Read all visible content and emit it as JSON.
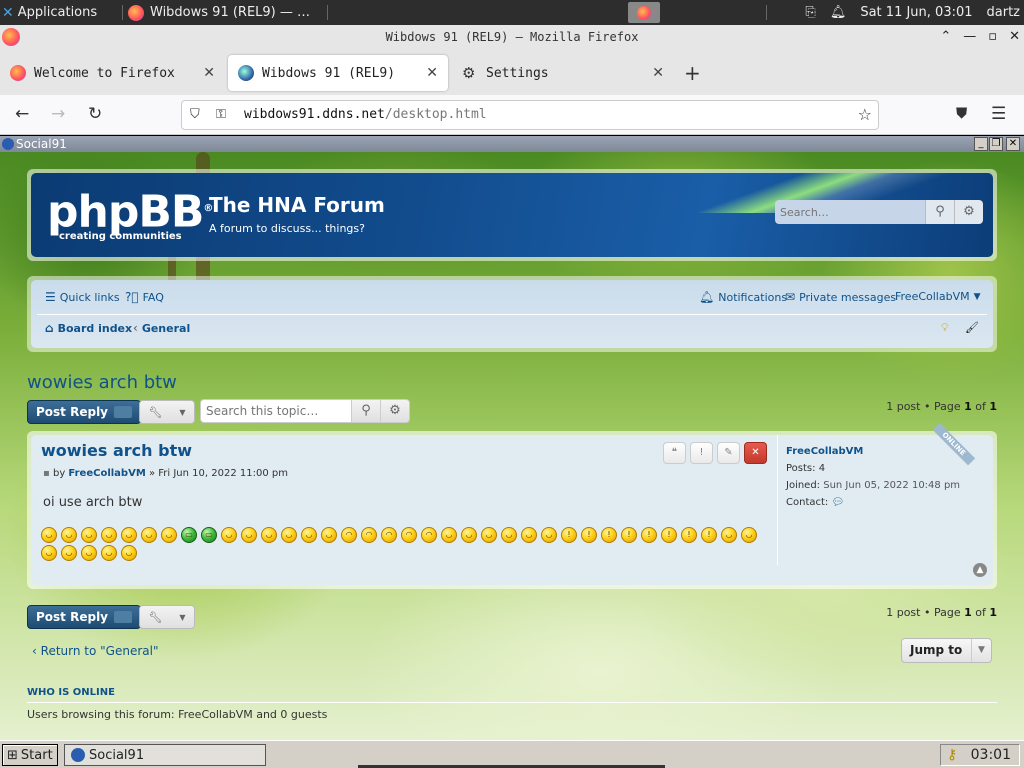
{
  "desktop": {
    "apps_label": "Applications",
    "task_title": "Wibdows 91 (REL9) — …",
    "datetime": "Sat 11 Jun, 03:01",
    "user": "dartz"
  },
  "browser": {
    "window_title": "Wibdows 91 (REL9) — Mozilla Firefox",
    "tabs": [
      {
        "label": "Welcome to Firefox"
      },
      {
        "label": "Wibdows 91 (REL9)"
      },
      {
        "label": "Settings"
      }
    ],
    "url_host": "wibdows91.ddns.net",
    "url_path": "/desktop.html"
  },
  "inner_window": {
    "title": "Social91"
  },
  "forum": {
    "logo_main": "phpBB",
    "logo_reg": "®",
    "logo_tagline": "creating communities",
    "title": "The HNA Forum",
    "description": "A forum to discuss... things?",
    "search_placeholder": "Search…",
    "nav": {
      "quick_links": "Quick links",
      "faq": "FAQ",
      "notifications": "Notifications",
      "private_messages": "Private messages",
      "user_menu": "FreeCollabVM",
      "board_index": "Board index",
      "crumb_general": "General"
    },
    "topic_title": "wowies arch btw",
    "post_reply": "Post Reply",
    "topic_search_placeholder": "Search this topic…",
    "pagination": {
      "prefix": "1 post • Page ",
      "page": "1",
      "of": " of ",
      "total": "1"
    },
    "post": {
      "title": "wowies arch btw",
      "by": "by ",
      "author": "FreeCollabVM",
      "date": " » Fri Jun 10, 2022 11:00 pm",
      "body": "oi use arch btw",
      "online_badge": "ONLINE",
      "profile": {
        "username": "FreeCollabVM",
        "posts_label": "Posts: ",
        "posts_value": "4",
        "joined_label": "Joined: ",
        "joined_value": "Sun Jun 05, 2022 10:48 pm",
        "contact_label": "Contact:"
      }
    },
    "return_link": "Return to \"General\"",
    "jump_to": "Jump to",
    "who_online_header": "WHO IS ONLINE",
    "who_online_text": "Users browsing this forum: FreeCollabVM and 0 guests"
  },
  "taskbar": {
    "start": "Start",
    "item": "Social91",
    "clock": "03:01"
  }
}
